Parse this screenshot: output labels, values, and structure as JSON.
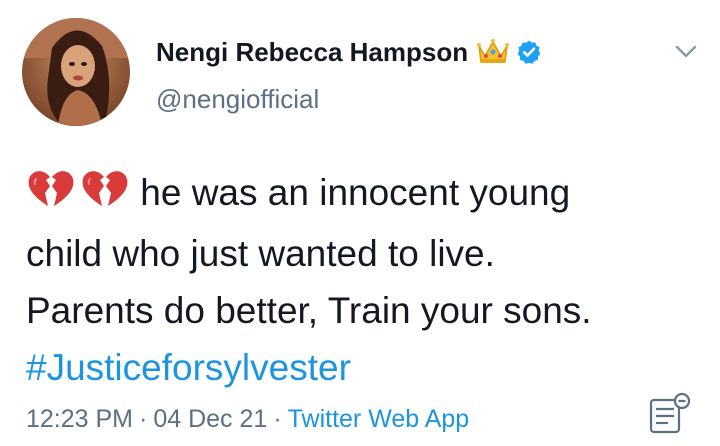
{
  "user": {
    "display_name": "Nengi Rebecca Hampson",
    "handle": "@nengiofficial"
  },
  "icons": {
    "avatar": "profile-photo",
    "crown": "crown-emoji",
    "verified": "verified-badge-icon",
    "more": "chevron-down-icon",
    "broken_heart": "broken-heart-emoji",
    "analytics": "tweet-analytics-icon"
  },
  "tweet": {
    "line1": "he was an innocent young",
    "line2": "child who just wanted to live.",
    "line3": "Parents do better, Train your sons.",
    "hashtag": "#Justiceforsylvester"
  },
  "meta": {
    "time": "12:23 PM",
    "separator": "·",
    "date": "04 Dec 21",
    "source": "Twitter Web App"
  },
  "colors": {
    "text": "#141823",
    "secondary": "#5b7083",
    "link": "#1b95e0",
    "verified": "#1da1f2",
    "heart": "#d93a3a"
  }
}
